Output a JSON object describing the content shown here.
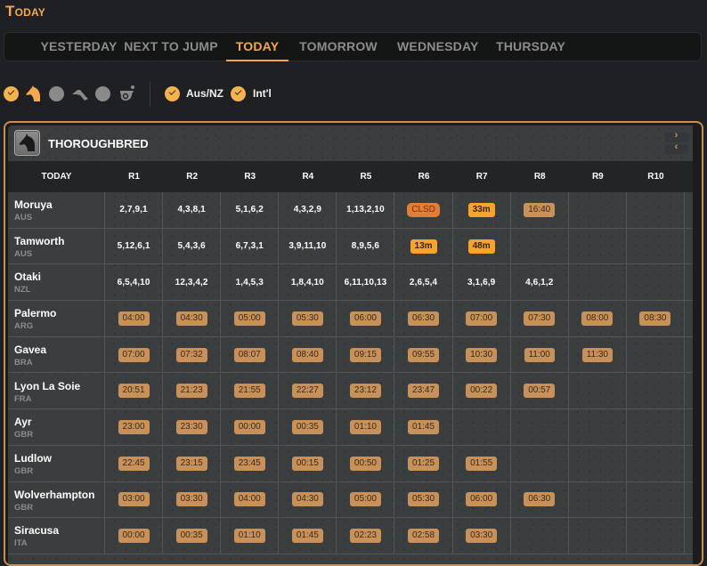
{
  "page": {
    "title": "Today"
  },
  "date_tabs": [
    {
      "label": "YESTERDAY",
      "active": false
    },
    {
      "label": "NEXT TO JUMP",
      "active": false
    },
    {
      "label": "TODAY",
      "active": true
    },
    {
      "label": "TOMORROW",
      "active": false
    },
    {
      "label": "WEDNESDAY",
      "active": false
    },
    {
      "label": "THURSDAY",
      "active": false
    }
  ],
  "filters": {
    "race_types": [
      {
        "name": "thoroughbred",
        "icon": "horse-head-icon",
        "checked": true
      },
      {
        "name": "harness",
        "icon": "harness-icon",
        "checked": false
      },
      {
        "name": "greyhound",
        "icon": "whistle-icon",
        "checked": false
      }
    ],
    "regions": [
      {
        "label": "Aus/NZ",
        "checked": true
      },
      {
        "label": "Int'l",
        "checked": true
      }
    ]
  },
  "panel": {
    "title": "THOROUGHBRED",
    "icon": "horse-head-icon",
    "scroll_next": "›",
    "scroll_prev": "‹",
    "colors": {
      "accent": "#f5a94a",
      "border": "#c48f59",
      "badge_time": "#c8915a",
      "badge_soon": "#f8a42a",
      "badge_closed": "#e07e35"
    }
  },
  "table": {
    "header_label": "TODAY",
    "races": [
      "R1",
      "R2",
      "R3",
      "R4",
      "R5",
      "R6",
      "R7",
      "R8",
      "R9",
      "R10",
      ""
    ],
    "rows": [
      {
        "venue": "Moruya",
        "country": "AUS",
        "cells": [
          {
            "type": "result",
            "text": "2,7,9,1"
          },
          {
            "type": "result",
            "text": "4,3,8,1"
          },
          {
            "type": "result",
            "text": "5,1,6,2"
          },
          {
            "type": "result",
            "text": "4,3,2,9"
          },
          {
            "type": "result",
            "text": "1,13,2,10"
          },
          {
            "type": "clsd",
            "text": "CLSD"
          },
          {
            "type": "soon",
            "text": "33m"
          },
          {
            "type": "time",
            "text": "16:40"
          },
          null,
          null,
          null
        ]
      },
      {
        "venue": "Tamworth",
        "country": "AUS",
        "cells": [
          {
            "type": "result",
            "text": "5,12,6,1"
          },
          {
            "type": "result",
            "text": "5,4,3,6"
          },
          {
            "type": "result",
            "text": "6,7,3,1"
          },
          {
            "type": "result",
            "text": "3,9,11,10"
          },
          {
            "type": "result",
            "text": "8,9,5,6"
          },
          {
            "type": "soon",
            "text": "13m"
          },
          {
            "type": "soon",
            "text": "48m"
          },
          null,
          null,
          null,
          null
        ]
      },
      {
        "venue": "Otaki",
        "country": "NZL",
        "cells": [
          {
            "type": "result",
            "text": "6,5,4,10"
          },
          {
            "type": "result",
            "text": "12,3,4,2"
          },
          {
            "type": "result",
            "text": "1,4,5,3"
          },
          {
            "type": "result",
            "text": "1,8,4,10"
          },
          {
            "type": "result",
            "text": "6,11,10,13"
          },
          {
            "type": "result",
            "text": "2,6,5,4"
          },
          {
            "type": "result",
            "text": "3,1,6,9"
          },
          {
            "type": "result",
            "text": "4,6,1,2"
          },
          null,
          null,
          null
        ]
      },
      {
        "venue": "Palermo",
        "country": "ARG",
        "cells": [
          {
            "type": "time",
            "text": "04:00"
          },
          {
            "type": "time",
            "text": "04:30"
          },
          {
            "type": "time",
            "text": "05:00"
          },
          {
            "type": "time",
            "text": "05:30"
          },
          {
            "type": "time",
            "text": "06:00"
          },
          {
            "type": "time",
            "text": "06:30"
          },
          {
            "type": "time",
            "text": "07:00"
          },
          {
            "type": "time",
            "text": "07:30"
          },
          {
            "type": "time",
            "text": "08:00"
          },
          {
            "type": "time",
            "text": "08:30"
          },
          {
            "type": "time",
            "text": ""
          }
        ]
      },
      {
        "venue": "Gavea",
        "country": "BRA",
        "cells": [
          {
            "type": "time",
            "text": "07:00"
          },
          {
            "type": "time",
            "text": "07:32"
          },
          {
            "type": "time",
            "text": "08:07"
          },
          {
            "type": "time",
            "text": "08:40"
          },
          {
            "type": "time",
            "text": "09:15"
          },
          {
            "type": "time",
            "text": "09:55"
          },
          {
            "type": "time",
            "text": "10:30"
          },
          {
            "type": "time",
            "text": "11:00"
          },
          {
            "type": "time",
            "text": "11:30"
          },
          null,
          null
        ]
      },
      {
        "venue": "Lyon La Soie",
        "country": "FRA",
        "cells": [
          {
            "type": "time",
            "text": "20:51"
          },
          {
            "type": "time",
            "text": "21:23"
          },
          {
            "type": "time",
            "text": "21:55"
          },
          {
            "type": "time",
            "text": "22:27"
          },
          {
            "type": "time",
            "text": "23:12"
          },
          {
            "type": "time",
            "text": "23:47"
          },
          {
            "type": "time",
            "text": "00:22"
          },
          {
            "type": "time",
            "text": "00:57"
          },
          null,
          null,
          null
        ]
      },
      {
        "venue": "Ayr",
        "country": "GBR",
        "cells": [
          {
            "type": "time",
            "text": "23:00"
          },
          {
            "type": "time",
            "text": "23:30"
          },
          {
            "type": "time",
            "text": "00:00"
          },
          {
            "type": "time",
            "text": "00:35"
          },
          {
            "type": "time",
            "text": "01:10"
          },
          {
            "type": "time",
            "text": "01:45"
          },
          null,
          null,
          null,
          null,
          null
        ]
      },
      {
        "venue": "Ludlow",
        "country": "GBR",
        "cells": [
          {
            "type": "time",
            "text": "22:45"
          },
          {
            "type": "time",
            "text": "23:15"
          },
          {
            "type": "time",
            "text": "23:45"
          },
          {
            "type": "time",
            "text": "00:15"
          },
          {
            "type": "time",
            "text": "00:50"
          },
          {
            "type": "time",
            "text": "01:25"
          },
          {
            "type": "time",
            "text": "01:55"
          },
          null,
          null,
          null,
          null
        ]
      },
      {
        "venue": "Wolverhampton",
        "country": "GBR",
        "cells": [
          {
            "type": "time",
            "text": "03:00"
          },
          {
            "type": "time",
            "text": "03:30"
          },
          {
            "type": "time",
            "text": "04:00"
          },
          {
            "type": "time",
            "text": "04:30"
          },
          {
            "type": "time",
            "text": "05:00"
          },
          {
            "type": "time",
            "text": "05:30"
          },
          {
            "type": "time",
            "text": "06:00"
          },
          {
            "type": "time",
            "text": "06:30"
          },
          null,
          null,
          null
        ]
      },
      {
        "venue": "Siracusa",
        "country": "ITA",
        "cells": [
          {
            "type": "time",
            "text": "00:00"
          },
          {
            "type": "time",
            "text": "00:35"
          },
          {
            "type": "time",
            "text": "01:10"
          },
          {
            "type": "time",
            "text": "01:45"
          },
          {
            "type": "time",
            "text": "02:23"
          },
          {
            "type": "time",
            "text": "02:58"
          },
          {
            "type": "time",
            "text": "03:30"
          },
          null,
          null,
          null,
          null
        ]
      }
    ]
  }
}
